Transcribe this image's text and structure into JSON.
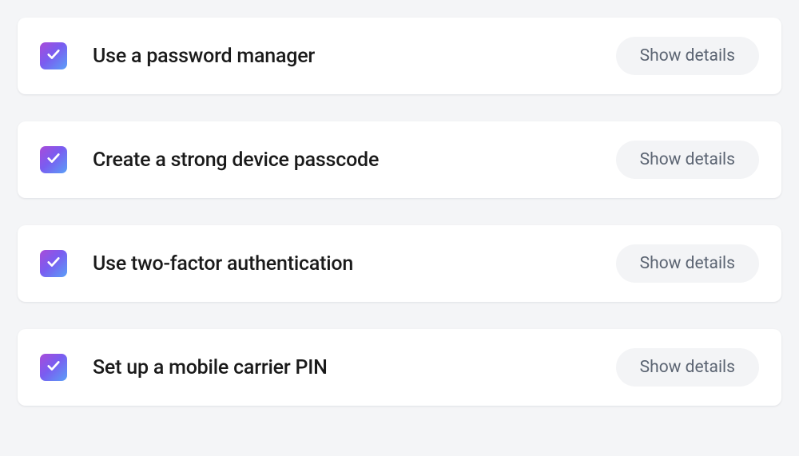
{
  "items": [
    {
      "id": "password-manager",
      "title": "Use a password manager",
      "checked": true,
      "action_label": "Show details"
    },
    {
      "id": "device-passcode",
      "title": "Create a strong device passcode",
      "checked": true,
      "action_label": "Show details"
    },
    {
      "id": "two-factor",
      "title": "Use two-factor authentication",
      "checked": true,
      "action_label": "Show details"
    },
    {
      "id": "carrier-pin",
      "title": "Set up a mobile carrier PIN",
      "checked": true,
      "action_label": "Show details"
    }
  ],
  "colors": {
    "page_bg": "#f4f5f7",
    "card_bg": "#ffffff",
    "title_text": "#1a1a1a",
    "button_bg": "#f3f4f6",
    "button_text": "#5b6472",
    "check_gradient_start": "#a94bd8",
    "check_gradient_end": "#5aa0f7"
  }
}
